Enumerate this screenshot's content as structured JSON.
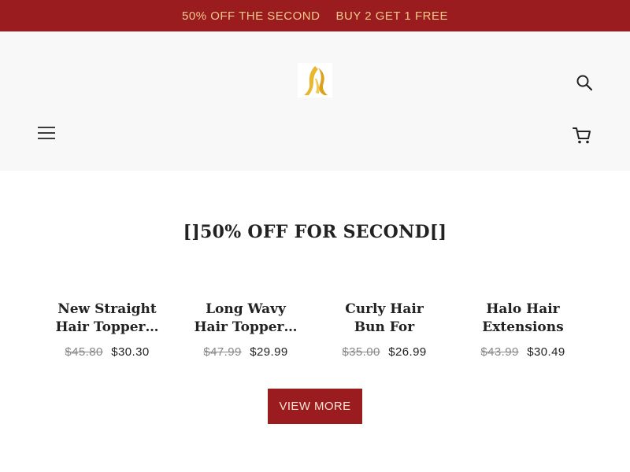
{
  "announcement": {
    "messages": [
      "50% OFF THE SECOND",
      "BUY 2 GET 1 FREE"
    ]
  },
  "header": {
    "logo_icon": "hair-silhouette-logo",
    "search_icon": "search-icon",
    "menu_icon": "hamburger-menu-icon",
    "cart_icon": "cart-icon"
  },
  "section": {
    "title": "[]50% OFF FOR SECOND[]"
  },
  "products": [
    {
      "name": "New Straight Hair Topper…",
      "old_price": "$45.80",
      "price": "$30.30"
    },
    {
      "name": "Long Wavy Hair Topper…",
      "old_price": "$47.99",
      "price": "$29.99"
    },
    {
      "name": "Curly Hair Bun For Women…",
      "old_price": "$35.00",
      "price": "$26.99"
    },
    {
      "name": "Halo Hair Extensions fo…",
      "old_price": "$43.99",
      "price": "$30.49"
    }
  ],
  "view_more_label": "VIEW MORE",
  "colors": {
    "brand_red": "#9a1c1f",
    "announcement_text": "#f3c98b",
    "logo_gold": "#e8b62f"
  }
}
